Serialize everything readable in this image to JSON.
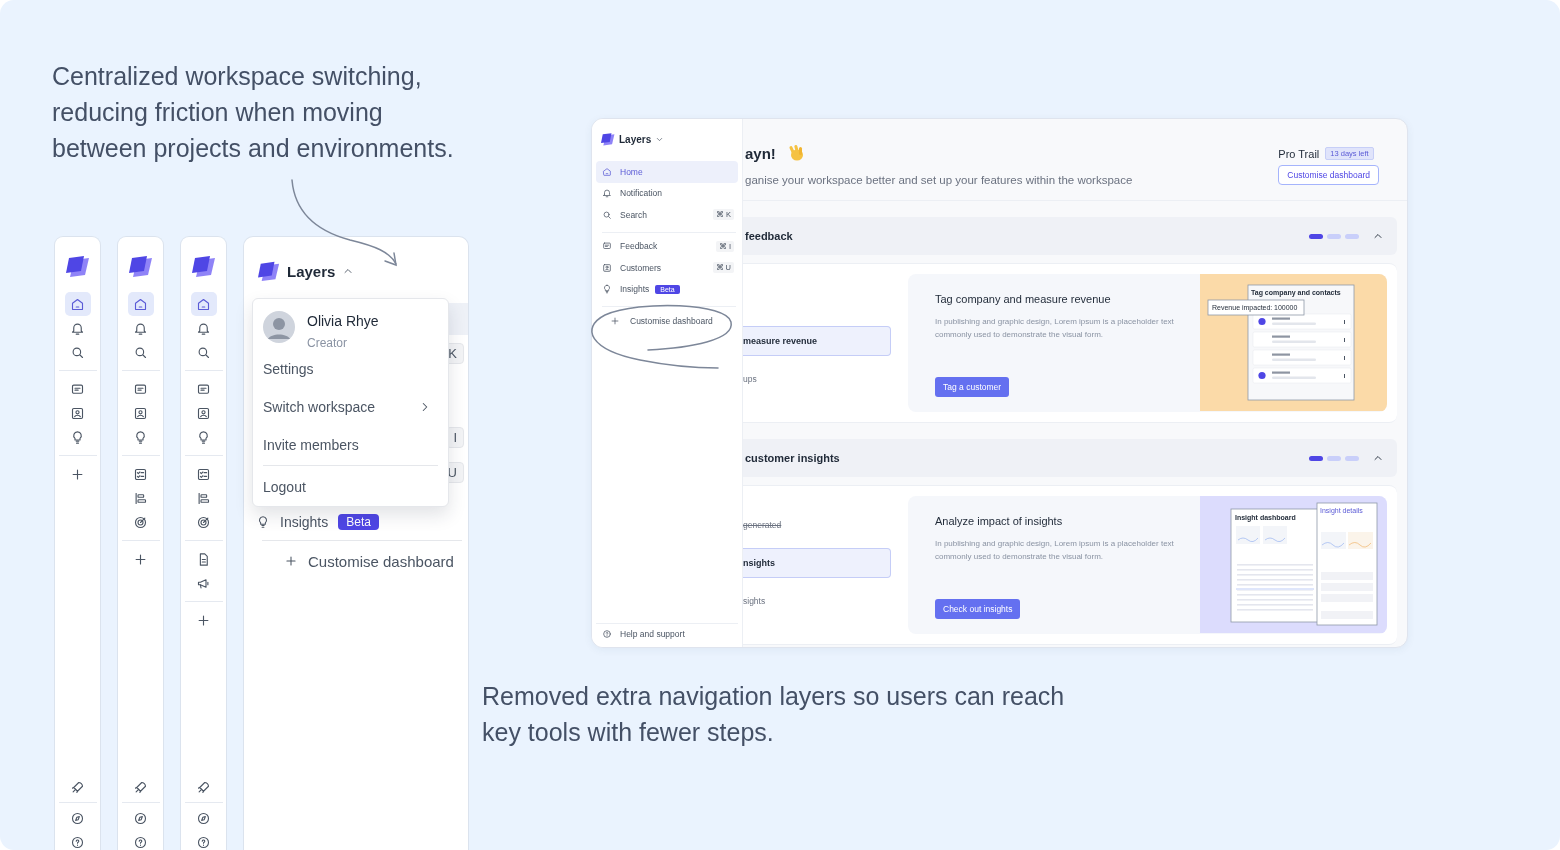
{
  "intro_caption": {
    "lines": [
      "Centralized workspace switching,",
      "reducing friction when moving",
      "between projects and environments."
    ]
  },
  "rails": [
    {
      "items": [
        {
          "kind": "home",
          "selected": true
        },
        {
          "kind": "bell",
          "selected": false
        },
        {
          "kind": "search",
          "selected": false
        },
        {
          "kind": "divider"
        },
        {
          "kind": "chat",
          "selected": false
        },
        {
          "kind": "contact",
          "selected": false
        },
        {
          "kind": "bulb",
          "selected": false
        },
        {
          "kind": "divider"
        },
        {
          "kind": "plus",
          "selected": false
        }
      ],
      "bottom_items": [
        {
          "kind": "rocket",
          "selected": false
        },
        {
          "kind": "divider"
        },
        {
          "kind": "compass",
          "selected": false
        },
        {
          "kind": "help",
          "selected": false
        }
      ]
    },
    {
      "items": [
        {
          "kind": "home",
          "selected": true
        },
        {
          "kind": "bell",
          "selected": false
        },
        {
          "kind": "search",
          "selected": false
        },
        {
          "kind": "divider"
        },
        {
          "kind": "chat",
          "selected": false
        },
        {
          "kind": "contact",
          "selected": false
        },
        {
          "kind": "bulb",
          "selected": false
        },
        {
          "kind": "divider"
        },
        {
          "kind": "checklist",
          "selected": false
        },
        {
          "kind": "bars",
          "selected": false
        },
        {
          "kind": "target",
          "selected": false
        },
        {
          "kind": "divider"
        },
        {
          "kind": "plus",
          "selected": false
        }
      ],
      "bottom_items": [
        {
          "kind": "rocket",
          "selected": false
        },
        {
          "kind": "divider"
        },
        {
          "kind": "compass",
          "selected": false
        },
        {
          "kind": "help",
          "selected": false
        }
      ]
    },
    {
      "items": [
        {
          "kind": "home",
          "selected": true
        },
        {
          "kind": "bell",
          "selected": false
        },
        {
          "kind": "search",
          "selected": false
        },
        {
          "kind": "divider"
        },
        {
          "kind": "chat",
          "selected": false
        },
        {
          "kind": "contact",
          "selected": false
        },
        {
          "kind": "bulb",
          "selected": false
        },
        {
          "kind": "divider"
        },
        {
          "kind": "checklist",
          "selected": false
        },
        {
          "kind": "bars",
          "selected": false
        },
        {
          "kind": "target",
          "selected": false
        },
        {
          "kind": "divider"
        },
        {
          "kind": "doc",
          "selected": false
        },
        {
          "kind": "megaphone",
          "selected": false
        },
        {
          "kind": "divider"
        },
        {
          "kind": "plus",
          "selected": false
        }
      ],
      "bottom_items": [
        {
          "kind": "rocket",
          "selected": false
        },
        {
          "kind": "divider"
        },
        {
          "kind": "compass",
          "selected": false
        },
        {
          "kind": "help",
          "selected": false
        }
      ]
    }
  ],
  "layers_panel": {
    "workspace": "Layers",
    "menu_open": true,
    "shortcuts": [
      "K",
      "I",
      "U"
    ],
    "insights": {
      "label": "Insights",
      "badge": "Beta"
    },
    "action": "Customise dashboard",
    "menu": {
      "user": {
        "name": "Olivia Rhye",
        "role": "Creator"
      },
      "items": [
        {
          "kind": "item",
          "label": "Settings",
          "submenu": false
        },
        {
          "kind": "item",
          "label": "Switch workspace",
          "submenu": true
        },
        {
          "kind": "item",
          "label": "Invite members",
          "submenu": false
        },
        {
          "kind": "divider"
        },
        {
          "kind": "item",
          "label": "Logout",
          "submenu": false
        }
      ]
    }
  },
  "app": {
    "sidebar": {
      "workspace": "Layers",
      "items": [
        {
          "kind": "home",
          "label": "Home",
          "selected": true
        },
        {
          "kind": "bell",
          "label": "Notification",
          "selected": false
        },
        {
          "kind": "search",
          "label": "Search",
          "shortcut": "⌘ K",
          "selected": false
        },
        {
          "kind": "divider"
        },
        {
          "kind": "chat",
          "label": "Feedback",
          "shortcut": "⌘ I",
          "selected": false
        },
        {
          "kind": "contact",
          "label": "Customers",
          "shortcut": "⌘ U",
          "selected": false
        },
        {
          "kind": "bulb",
          "label": "Insights",
          "badge": "Beta",
          "selected": false
        },
        {
          "kind": "divider"
        },
        {
          "kind": "plus",
          "label": "Customise dashboard",
          "selected": false
        }
      ],
      "footer": "Help and support"
    },
    "header": {
      "greeting": "ayn!",
      "subtitle": "ganise your workspace better and set up your features within the workspace",
      "plan": "Pro Trail",
      "trial_badge": "13 days left",
      "button": "Customise dashboard"
    },
    "sections": [
      {
        "title": "feedback",
        "expanded": true,
        "dots": [
          {
            "selected": true
          },
          {
            "selected": false
          },
          {
            "selected": false
          }
        ],
        "items": [
          {
            "label": "measure revenue",
            "selected": true,
            "done": false
          },
          {
            "label": "ups",
            "selected": false,
            "done": false
          }
        ],
        "card": {
          "title": "Tag company and measure revenue",
          "text": "In publishing and graphic design, Lorem ipsum is a placeholder text commonly used to demonstrate the visual form.",
          "button": "Tag a customer",
          "illustration": {
            "kind": "contacts",
            "title": "Tag company and contacts",
            "label": "Revenue impacted:",
            "value": "100000"
          }
        }
      },
      {
        "title": "customer insights",
        "expanded": true,
        "dots": [
          {
            "selected": true
          },
          {
            "selected": false
          },
          {
            "selected": false
          }
        ],
        "items": [
          {
            "label": "generated",
            "selected": false,
            "done": true
          },
          {
            "label": "nsights",
            "selected": true,
            "done": false
          },
          {
            "label": "sights",
            "selected": false,
            "done": false
          }
        ],
        "card": {
          "title": "Analyze impact of insights",
          "text": "In publishing and graphic design, Lorem ipsum is a placeholder text commonly used to demonstrate the visual form.",
          "button": "Check out insights",
          "illustration": {
            "kind": "dashboard",
            "title": "Insight dashboard",
            "subtitle": "Insight details"
          }
        }
      }
    ]
  },
  "outro_caption": {
    "lines": [
      "Removed extra navigation layers so users can reach",
      "key tools with fewer steps."
    ]
  }
}
